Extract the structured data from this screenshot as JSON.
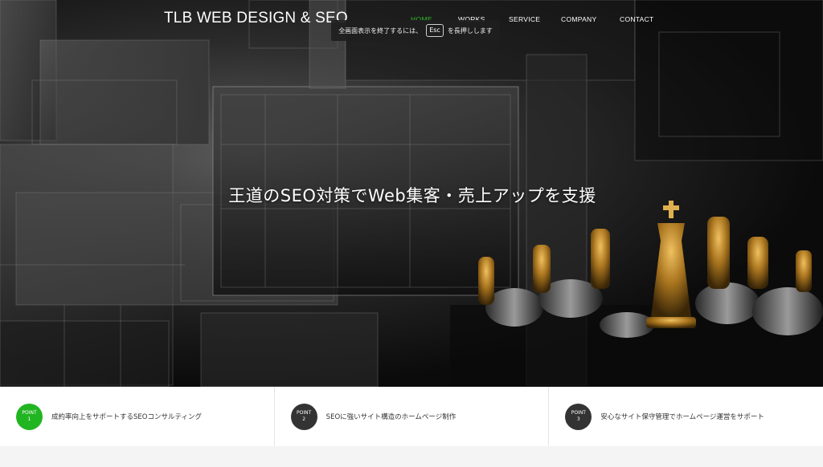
{
  "header": {
    "logo": "TLB WEB DESIGN & SEO",
    "nav": [
      {
        "label": "HOME",
        "active": true
      },
      {
        "label": "WORKS",
        "active": false
      },
      {
        "label": "SERVICE",
        "active": false
      },
      {
        "label": "COMPANY",
        "active": false
      },
      {
        "label": "CONTACT",
        "active": false
      }
    ]
  },
  "fullscreen_notice": {
    "before": "全画面表示を終了するには、",
    "key": "Esc",
    "after": "を長押しします"
  },
  "hero": {
    "headline": "王道のSEO対策でWeb集客・売上アップを支援"
  },
  "points": [
    {
      "badge_label": "POINT",
      "badge_num": "1",
      "text": "成約率向上をサポートするSEOコンサルティング"
    },
    {
      "badge_label": "POINT",
      "badge_num": "2",
      "text": "SEOに強いサイト構造のホームページ制作"
    },
    {
      "badge_label": "POINT",
      "badge_num": "3",
      "text": "安心なサイト保守管理でホームページ運営をサポート"
    }
  ],
  "colors": {
    "accent": "#22b522",
    "nav_active": "#2dbb2d",
    "badge": "#333333"
  }
}
